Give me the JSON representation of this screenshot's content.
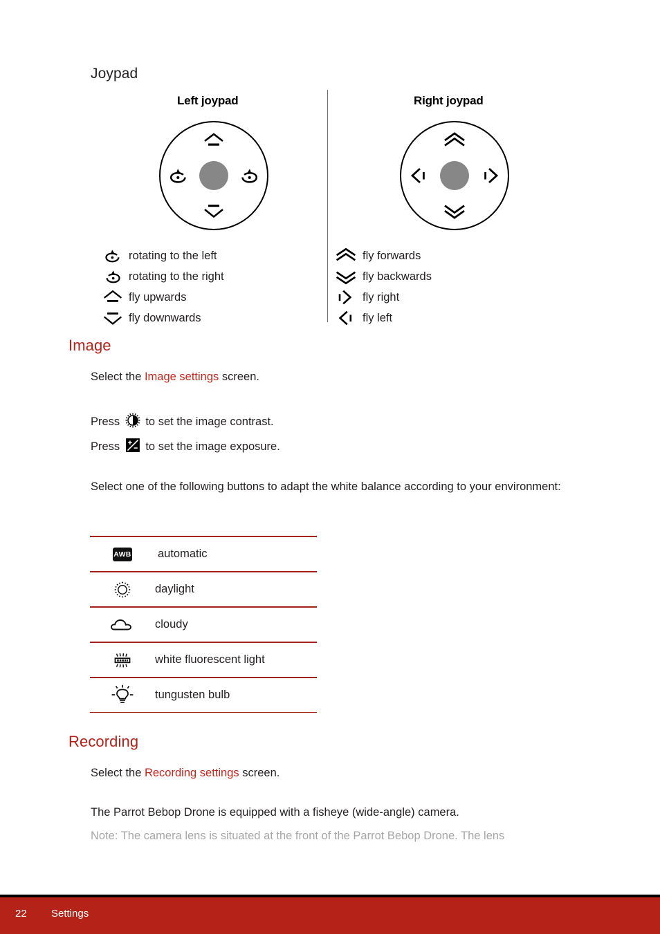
{
  "document": {
    "section_joypad_title": "Joypad",
    "section_image_title": "Image",
    "section_recording_title": "Recording"
  },
  "joypad": {
    "left": {
      "title": "Left joypad",
      "legend": [
        {
          "icon": "rotate-left-icon",
          "label": "rotating to the left"
        },
        {
          "icon": "rotate-right-icon",
          "label": "rotating to the right"
        },
        {
          "icon": "fly-upwards-icon",
          "label": "fly upwards"
        },
        {
          "icon": "fly-downwards-icon",
          "label": "fly downwards"
        }
      ]
    },
    "right": {
      "title": "Right joypad",
      "legend": [
        {
          "icon": "fly-forwards-icon",
          "label": "fly forwards"
        },
        {
          "icon": "fly-backwards-icon",
          "label": "fly backwards"
        },
        {
          "icon": "fly-right-icon",
          "label": "fly right"
        },
        {
          "icon": "fly-left-icon",
          "label": "fly left"
        }
      ]
    }
  },
  "image_section": {
    "select_prefix": "Select the ",
    "select_link": "Image settings",
    "select_suffix": " screen.",
    "press_contrast_prefix": "Press ",
    "press_contrast_suffix": " to set the image contrast.",
    "press_exposure_prefix": "Press ",
    "press_exposure_suffix": " to set the image exposure.",
    "white_balance_intro": "Select one of the following buttons to adapt the white balance according to your environment:",
    "contrast_icon": "contrast-icon",
    "exposure_icon": "exposure-icon"
  },
  "white_balance_table": {
    "rows": [
      {
        "icon": "awb-icon",
        "icon_text": "AWB",
        "label": "automatic"
      },
      {
        "icon": "daylight-icon",
        "label": "daylight"
      },
      {
        "icon": "cloudy-icon",
        "label": "cloudy"
      },
      {
        "icon": "fluorescent-icon",
        "label": "white fluorescent light"
      },
      {
        "icon": "tungsten-icon",
        "label": "tungusten bulb"
      }
    ]
  },
  "recording_section": {
    "select_prefix": "Select the ",
    "select_link": "Recording settings",
    "select_suffix": " screen.",
    "body": "The Parrot Bebop Drone is equipped with a fisheye (wide-angle) camera.",
    "note": "Note: The camera lens is situated at the front of the Parrot Bebop Drone. The lens"
  },
  "footer": {
    "page_number": "22",
    "label": "Settings"
  },
  "colors": {
    "accent_red": "#b42218",
    "link_red": "#c0271d",
    "rule_red": "#a32118",
    "note_gray": "#a6a6a6",
    "hub_gray": "#878787"
  }
}
